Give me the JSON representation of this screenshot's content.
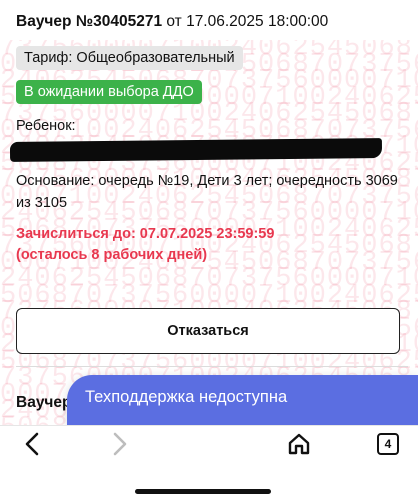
{
  "voucher": {
    "label": "Ваучер №30405271",
    "date_text": " от 17.06.2025 18:00:00",
    "tariff": "Тариф: Общеобразовательный",
    "status": "В ожидании выбора ДДО",
    "child_label": "Ребенок:",
    "basis": "Основание: очередь №19, Дети 3 лет; очередность 3069 из 3105",
    "deadline_line1": "Зачислиться до: 07.07.2025 23:59:59",
    "deadline_line2": "(осталось 8 рабочих дней)",
    "refuse_label": "Отказаться"
  },
  "next_voucher": {
    "title": "Ваучер"
  },
  "watermark": {
    "lines": [
      "737560000710024062545068707375600",
      "000710024062545068707375600007100",
      "240625450687073756000071002406254",
      "506870737560000710024062545068707"
    ]
  },
  "support": {
    "label": "Техподдержка недоступна"
  },
  "browser_nav": {
    "tab_count": "4"
  },
  "colors": {
    "accent_red": "#e8384f",
    "status_green": "#3cb24a",
    "support_blue": "#5b6ee1"
  }
}
